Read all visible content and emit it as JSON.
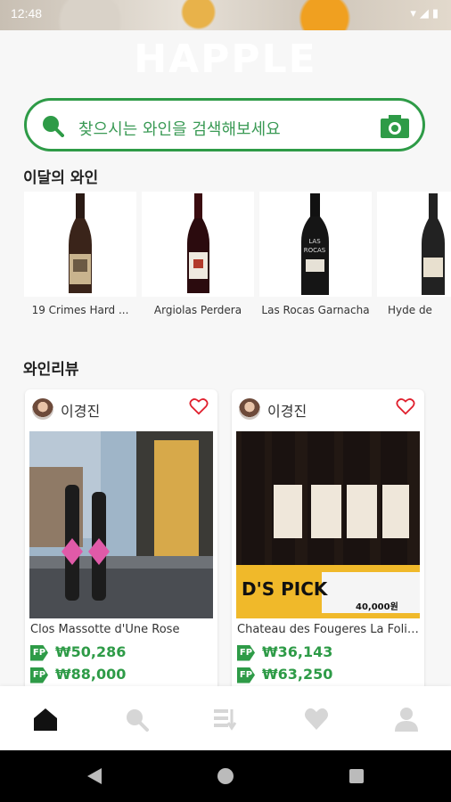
{
  "status": {
    "time": "12:48",
    "right_icons": "▾◢▮"
  },
  "brand": {
    "logo_text": "HAPPLE"
  },
  "search": {
    "placeholder": "찾으시는 와인을 검색해보세요"
  },
  "wine_of_month": {
    "title": "이달의 와인",
    "items": [
      {
        "name": "19 Crimes Hard ..."
      },
      {
        "name": "Argiolas Perdera"
      },
      {
        "name": "Las Rocas Garnacha"
      },
      {
        "name": "Hyde de"
      }
    ]
  },
  "reviews": {
    "title": "와인리뷰",
    "cards": [
      {
        "user": "이경진",
        "wine_name": "Clos Massotte d'Une Rose",
        "price_1": "₩50,286",
        "price_2": "₩88,000"
      },
      {
        "user": "이경진",
        "wine_name": "Chateau des Fougeres La Folie...",
        "price_1": "₩36,143",
        "price_2": "₩63,250",
        "photo_sign": "D'S PICK",
        "photo_price": "40,000원"
      }
    ]
  },
  "bottom_nav": {
    "items": [
      "home-icon",
      "search-icon",
      "ranking-icon",
      "heart-icon",
      "profile-icon"
    ],
    "active": "home-icon"
  },
  "colors": {
    "accent": "#2e9b47",
    "heart": "#e0202e"
  }
}
